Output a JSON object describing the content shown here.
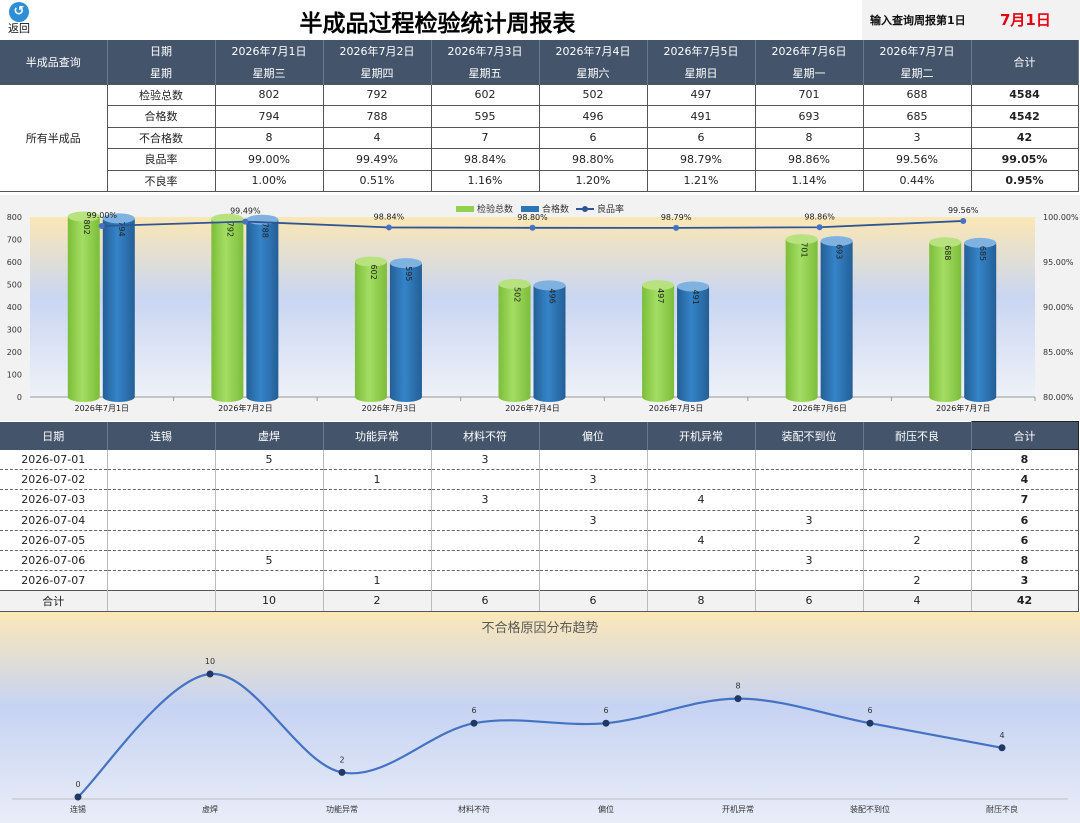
{
  "header": {
    "back_label": "返回",
    "title": "半成品过程检验统计周报表",
    "query_label": "输入查询周报第1日",
    "query_value": "7月1日"
  },
  "summary_table": {
    "corner_label": "半成品查询",
    "group_label": "所有半成品",
    "date_row_label": "日期",
    "week_row_label": "星期",
    "total_label": "合计",
    "dates": [
      "2026年7月1日",
      "2026年7月2日",
      "2026年7月3日",
      "2026年7月4日",
      "2026年7月5日",
      "2026年7月6日",
      "2026年7月7日"
    ],
    "weekdays": [
      "星期三",
      "星期四",
      "星期五",
      "星期六",
      "星期日",
      "星期一",
      "星期二"
    ],
    "rows": [
      {
        "label": "检验总数",
        "values": [
          "802",
          "792",
          "602",
          "502",
          "497",
          "701",
          "688"
        ],
        "total": "4584"
      },
      {
        "label": "合格数",
        "values": [
          "794",
          "788",
          "595",
          "496",
          "491",
          "693",
          "685"
        ],
        "total": "4542"
      },
      {
        "label": "不合格数",
        "values": [
          "8",
          "4",
          "7",
          "6",
          "6",
          "8",
          "3"
        ],
        "total": "42"
      },
      {
        "label": "良品率",
        "values": [
          "99.00%",
          "99.49%",
          "98.84%",
          "98.80%",
          "98.79%",
          "98.86%",
          "99.56%"
        ],
        "total": "99.05%"
      },
      {
        "label": "不良率",
        "values": [
          "1.00%",
          "0.51%",
          "1.16%",
          "1.20%",
          "1.21%",
          "1.14%",
          "0.44%"
        ],
        "total": "0.95%"
      }
    ]
  },
  "defect_table": {
    "headers": [
      "日期",
      "连锡",
      "虚焊",
      "功能异常",
      "材料不符",
      "偏位",
      "开机异常",
      "装配不到位",
      "耐压不良",
      "合计"
    ],
    "rows": [
      [
        "2026-07-01",
        "",
        "5",
        "",
        "3",
        "",
        "",
        "",
        "",
        "8"
      ],
      [
        "2026-07-02",
        "",
        "",
        "1",
        "",
        "3",
        "",
        "",
        "",
        "4"
      ],
      [
        "2026-07-03",
        "",
        "",
        "",
        "3",
        "",
        "4",
        "",
        "",
        "7"
      ],
      [
        "2026-07-04",
        "",
        "",
        "",
        "",
        "3",
        "",
        "3",
        "",
        "6"
      ],
      [
        "2026-07-05",
        "",
        "",
        "",
        "",
        "",
        "4",
        "",
        "2",
        "6"
      ],
      [
        "2026-07-06",
        "",
        "5",
        "",
        "",
        "",
        "",
        "3",
        "",
        "8"
      ],
      [
        "2026-07-07",
        "",
        "",
        "1",
        "",
        "",
        "",
        "",
        "2",
        "3"
      ]
    ],
    "total_row": [
      "合计",
      "",
      "10",
      "2",
      "6",
      "6",
      "8",
      "6",
      "4",
      "42"
    ]
  },
  "chart_data": [
    {
      "type": "bar",
      "categories": [
        "2026年7月1日",
        "2026年7月2日",
        "2026年7月3日",
        "2026年7月4日",
        "2026年7月5日",
        "2026年7月6日",
        "2026年7月7日"
      ],
      "series": [
        {
          "name": "检验总数",
          "type": "bar",
          "values": [
            802,
            792,
            602,
            502,
            497,
            701,
            688
          ],
          "color": "#92d050"
        },
        {
          "name": "合格数",
          "type": "bar",
          "values": [
            794,
            788,
            595,
            496,
            491,
            693,
            685
          ],
          "color": "#2e75b6"
        },
        {
          "name": "良品率",
          "type": "line",
          "axis": "right",
          "values": [
            99.0,
            99.49,
            98.84,
            98.8,
            98.79,
            98.86,
            99.56
          ],
          "color": "#2f5597"
        }
      ],
      "yticks_left": [
        "0",
        "100",
        "200",
        "300",
        "400",
        "500",
        "600",
        "700",
        "800"
      ],
      "yticks_right": [
        "80.00%",
        "85.00%",
        "90.00%",
        "95.00%",
        "100.00%"
      ],
      "ylim_left": [
        0,
        800
      ],
      "ylim_right": [
        80,
        100
      ],
      "legend": "top-center",
      "grid": false
    },
    {
      "type": "line",
      "title": "不合格原因分布趋势",
      "categories": [
        "连锡",
        "虚焊",
        "功能异常",
        "材料不符",
        "偏位",
        "开机异常",
        "装配不到位",
        "耐压不良"
      ],
      "values": [
        0,
        10,
        2,
        6,
        6,
        8,
        6,
        4
      ],
      "ylim": [
        0,
        10
      ],
      "smooth": true,
      "color": "#4472c4",
      "legend": "none",
      "grid": false
    }
  ]
}
